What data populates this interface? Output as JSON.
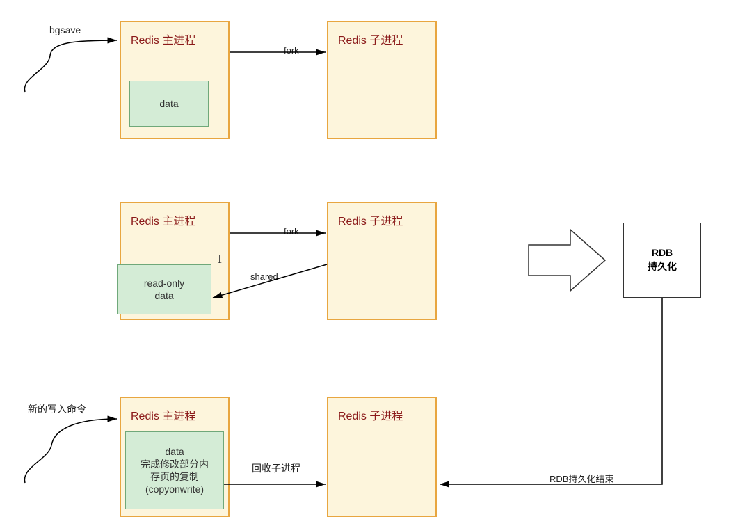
{
  "row1": {
    "incoming_label": "bgsave",
    "main_title": "Redis 主进程",
    "data_label": "data",
    "fork_label": "fork",
    "child_title": "Redis 子进程"
  },
  "row2": {
    "main_title": "Redis 主进程",
    "data_label_line1": "read-only",
    "data_label_line2": "data",
    "fork_label": "fork",
    "shared_label": "shared",
    "child_title": "Redis 子进程"
  },
  "row3": {
    "incoming_label": "新的写入命令",
    "main_title": "Redis 主进程",
    "data_label_line1": "data",
    "data_label_line2": "完成修改部分内",
    "data_label_line3": "存页的复制",
    "data_label_line4": "(copyonwrite)",
    "reclaim_label": "回收子进程",
    "child_title": "Redis 子进程",
    "rdb_end_label": "RDB持久化结束"
  },
  "rdb": {
    "title_line1": "RDB",
    "title_line2": "持久化"
  }
}
